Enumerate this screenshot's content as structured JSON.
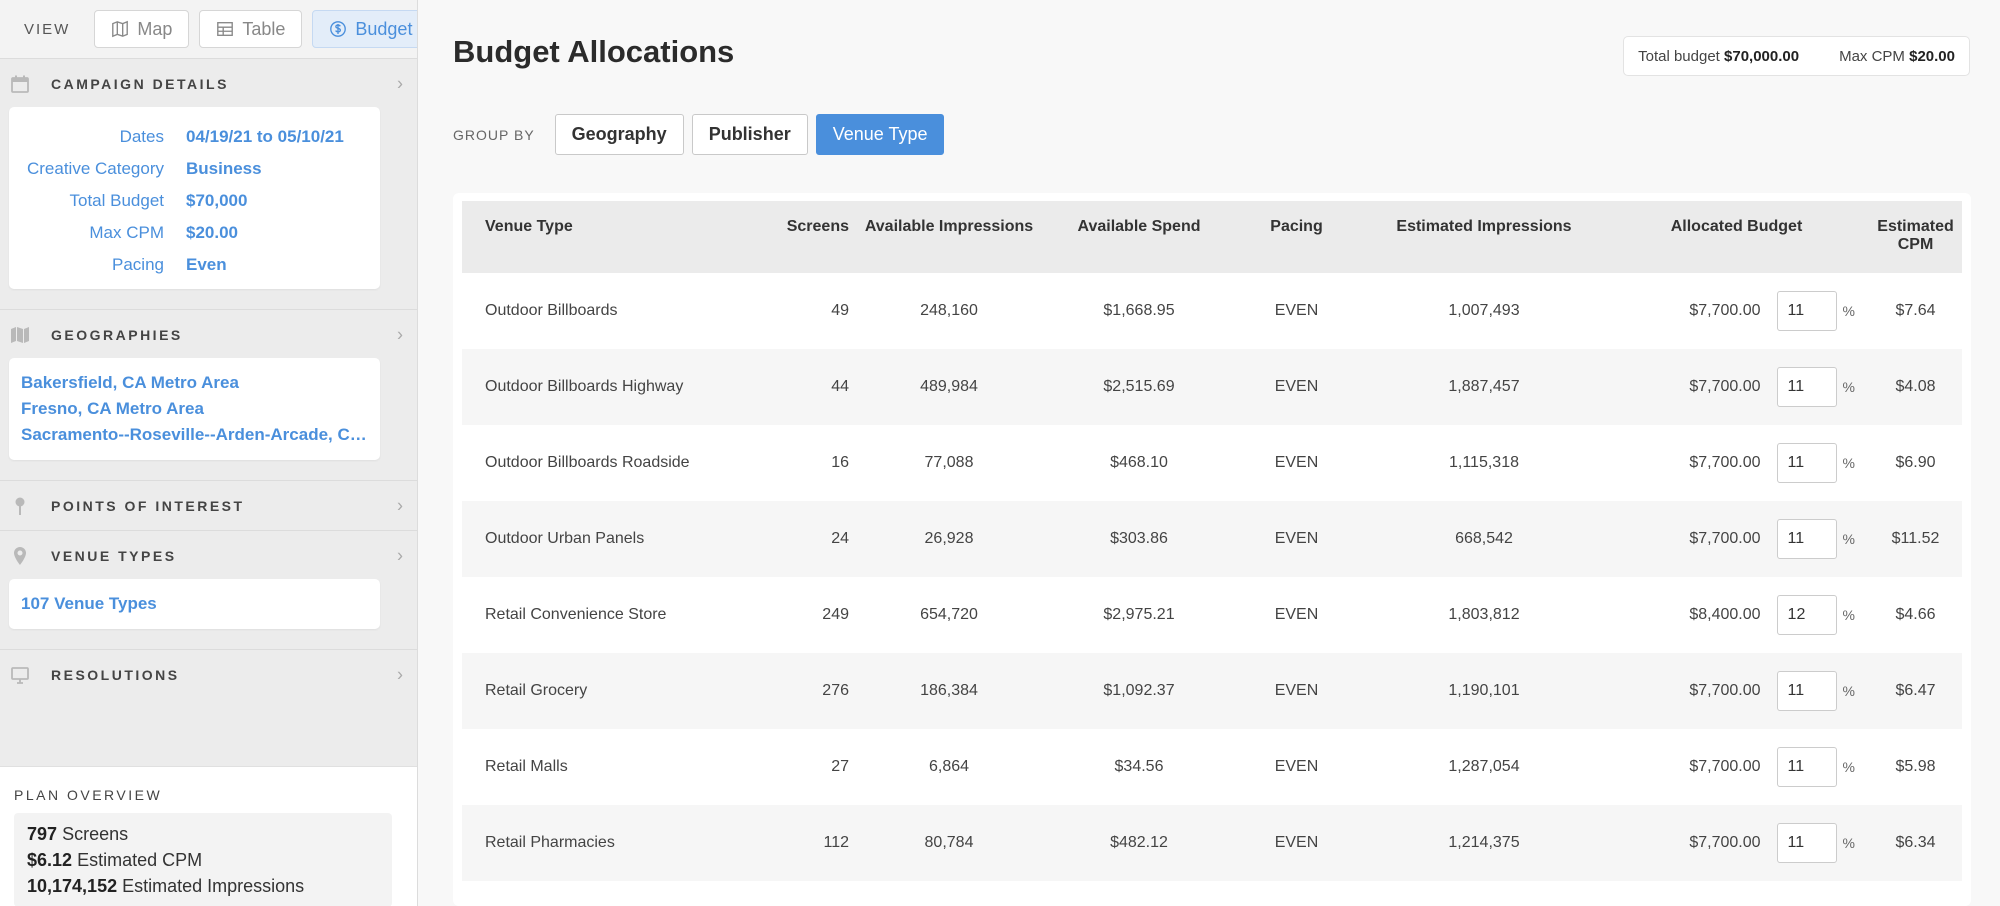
{
  "view": {
    "label": "VIEW",
    "buttons": [
      {
        "label": "Map",
        "icon": "map-icon",
        "active": false
      },
      {
        "label": "Table",
        "icon": "table-icon",
        "active": false
      },
      {
        "label": "Budget",
        "icon": "dollar-circle-icon",
        "active": true
      }
    ]
  },
  "campaign": {
    "title": "CAMPAIGN DETAILS",
    "rows": [
      {
        "key": "Dates",
        "value": "04/19/21 to 05/10/21"
      },
      {
        "key": "Creative Category",
        "value": "Business"
      },
      {
        "key": "Total Budget",
        "value": "$70,000"
      },
      {
        "key": "Max CPM",
        "value": "$20.00"
      },
      {
        "key": "Pacing",
        "value": "Even"
      }
    ]
  },
  "geographies": {
    "title": "GEOGRAPHIES",
    "items": [
      "Bakersfield, CA Metro Area",
      "Fresno, CA Metro Area",
      "Sacramento--Roseville--Arden-Arcade, CA M..."
    ]
  },
  "poi": {
    "title": "POINTS OF INTEREST"
  },
  "venue_types": {
    "title": "VENUE TYPES",
    "summary": "107 Venue Types"
  },
  "resolutions": {
    "title": "RESOLUTIONS"
  },
  "plan": {
    "title": "PLAN OVERVIEW",
    "screens_value": "797",
    "screens_label": "Screens",
    "cpm_value": "$6.12",
    "cpm_label": "Estimated CPM",
    "impressions_value": "10,174,152",
    "impressions_label": "Estimated Impressions"
  },
  "main": {
    "title": "Budget Allocations",
    "total_budget_label": "Total budget",
    "total_budget_value": "$70,000.00",
    "max_cpm_label": "Max CPM",
    "max_cpm_value": "$20.00",
    "groupby_label": "GROUP BY",
    "groupby_options": [
      {
        "label": "Geography",
        "active": false
      },
      {
        "label": "Publisher",
        "active": false
      },
      {
        "label": "Venue Type",
        "active": true
      }
    ]
  },
  "table": {
    "headers": {
      "venue": "Venue Type",
      "screens": "Screens",
      "avail_imp": "Available Impressions",
      "avail_spend": "Available Spend",
      "pacing": "Pacing",
      "est_imp": "Estimated Impressions",
      "alloc": "Allocated Budget",
      "est_cpm": "Estimated CPM"
    },
    "percent_symbol": "%",
    "rows": [
      {
        "venue": "Outdoor Billboards",
        "screens": "49",
        "avail_imp": "248,160",
        "avail_spend": "$1,668.95",
        "pacing": "EVEN",
        "est_imp": "1,007,493",
        "alloc": "$7,700.00",
        "pct": "11",
        "est_cpm": "$7.64"
      },
      {
        "venue": "Outdoor Billboards Highway",
        "screens": "44",
        "avail_imp": "489,984",
        "avail_spend": "$2,515.69",
        "pacing": "EVEN",
        "est_imp": "1,887,457",
        "alloc": "$7,700.00",
        "pct": "11",
        "est_cpm": "$4.08"
      },
      {
        "venue": "Outdoor Billboards Roadside",
        "screens": "16",
        "avail_imp": "77,088",
        "avail_spend": "$468.10",
        "pacing": "EVEN",
        "est_imp": "1,115,318",
        "alloc": "$7,700.00",
        "pct": "11",
        "est_cpm": "$6.90"
      },
      {
        "venue": "Outdoor Urban Panels",
        "screens": "24",
        "avail_imp": "26,928",
        "avail_spend": "$303.86",
        "pacing": "EVEN",
        "est_imp": "668,542",
        "alloc": "$7,700.00",
        "pct": "11",
        "est_cpm": "$11.52"
      },
      {
        "venue": "Retail Convenience Store",
        "screens": "249",
        "avail_imp": "654,720",
        "avail_spend": "$2,975.21",
        "pacing": "EVEN",
        "est_imp": "1,803,812",
        "alloc": "$8,400.00",
        "pct": "12",
        "est_cpm": "$4.66"
      },
      {
        "venue": "Retail Grocery",
        "screens": "276",
        "avail_imp": "186,384",
        "avail_spend": "$1,092.37",
        "pacing": "EVEN",
        "est_imp": "1,190,101",
        "alloc": "$7,700.00",
        "pct": "11",
        "est_cpm": "$6.47"
      },
      {
        "venue": "Retail Malls",
        "screens": "27",
        "avail_imp": "6,864",
        "avail_spend": "$34.56",
        "pacing": "EVEN",
        "est_imp": "1,287,054",
        "alloc": "$7,700.00",
        "pct": "11",
        "est_cpm": "$5.98"
      },
      {
        "venue": "Retail Pharmacies",
        "screens": "112",
        "avail_imp": "80,784",
        "avail_spend": "$482.12",
        "pacing": "EVEN",
        "est_imp": "1,214,375",
        "alloc": "$7,700.00",
        "pct": "11",
        "est_cpm": "$6.34"
      }
    ]
  },
  "colors": {
    "accent": "#4a8fdc",
    "sidebar_bg": "#ececec",
    "page_bg": "#f8f8f8",
    "header_bg": "#ebebeb"
  }
}
